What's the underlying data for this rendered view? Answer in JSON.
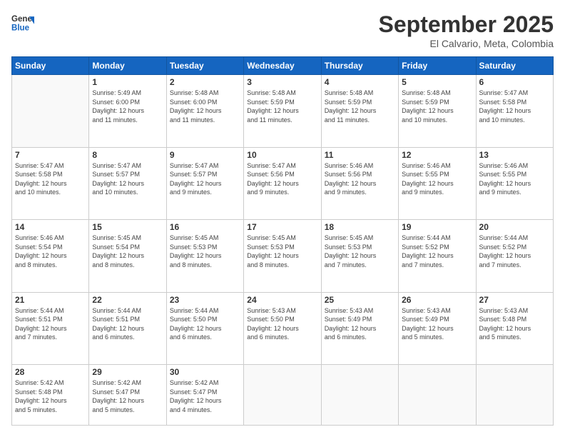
{
  "logo": {
    "line1": "General",
    "line2": "Blue"
  },
  "title": "September 2025",
  "location": "El Calvario, Meta, Colombia",
  "weekdays": [
    "Sunday",
    "Monday",
    "Tuesday",
    "Wednesday",
    "Thursday",
    "Friday",
    "Saturday"
  ],
  "weeks": [
    [
      {
        "day": "",
        "info": ""
      },
      {
        "day": "1",
        "info": "Sunrise: 5:49 AM\nSunset: 6:00 PM\nDaylight: 12 hours\nand 11 minutes."
      },
      {
        "day": "2",
        "info": "Sunrise: 5:48 AM\nSunset: 6:00 PM\nDaylight: 12 hours\nand 11 minutes."
      },
      {
        "day": "3",
        "info": "Sunrise: 5:48 AM\nSunset: 5:59 PM\nDaylight: 12 hours\nand 11 minutes."
      },
      {
        "day": "4",
        "info": "Sunrise: 5:48 AM\nSunset: 5:59 PM\nDaylight: 12 hours\nand 11 minutes."
      },
      {
        "day": "5",
        "info": "Sunrise: 5:48 AM\nSunset: 5:59 PM\nDaylight: 12 hours\nand 10 minutes."
      },
      {
        "day": "6",
        "info": "Sunrise: 5:47 AM\nSunset: 5:58 PM\nDaylight: 12 hours\nand 10 minutes."
      }
    ],
    [
      {
        "day": "7",
        "info": "Sunrise: 5:47 AM\nSunset: 5:58 PM\nDaylight: 12 hours\nand 10 minutes."
      },
      {
        "day": "8",
        "info": "Sunrise: 5:47 AM\nSunset: 5:57 PM\nDaylight: 12 hours\nand 10 minutes."
      },
      {
        "day": "9",
        "info": "Sunrise: 5:47 AM\nSunset: 5:57 PM\nDaylight: 12 hours\nand 9 minutes."
      },
      {
        "day": "10",
        "info": "Sunrise: 5:47 AM\nSunset: 5:56 PM\nDaylight: 12 hours\nand 9 minutes."
      },
      {
        "day": "11",
        "info": "Sunrise: 5:46 AM\nSunset: 5:56 PM\nDaylight: 12 hours\nand 9 minutes."
      },
      {
        "day": "12",
        "info": "Sunrise: 5:46 AM\nSunset: 5:55 PM\nDaylight: 12 hours\nand 9 minutes."
      },
      {
        "day": "13",
        "info": "Sunrise: 5:46 AM\nSunset: 5:55 PM\nDaylight: 12 hours\nand 9 minutes."
      }
    ],
    [
      {
        "day": "14",
        "info": "Sunrise: 5:46 AM\nSunset: 5:54 PM\nDaylight: 12 hours\nand 8 minutes."
      },
      {
        "day": "15",
        "info": "Sunrise: 5:45 AM\nSunset: 5:54 PM\nDaylight: 12 hours\nand 8 minutes."
      },
      {
        "day": "16",
        "info": "Sunrise: 5:45 AM\nSunset: 5:53 PM\nDaylight: 12 hours\nand 8 minutes."
      },
      {
        "day": "17",
        "info": "Sunrise: 5:45 AM\nSunset: 5:53 PM\nDaylight: 12 hours\nand 8 minutes."
      },
      {
        "day": "18",
        "info": "Sunrise: 5:45 AM\nSunset: 5:53 PM\nDaylight: 12 hours\nand 7 minutes."
      },
      {
        "day": "19",
        "info": "Sunrise: 5:44 AM\nSunset: 5:52 PM\nDaylight: 12 hours\nand 7 minutes."
      },
      {
        "day": "20",
        "info": "Sunrise: 5:44 AM\nSunset: 5:52 PM\nDaylight: 12 hours\nand 7 minutes."
      }
    ],
    [
      {
        "day": "21",
        "info": "Sunrise: 5:44 AM\nSunset: 5:51 PM\nDaylight: 12 hours\nand 7 minutes."
      },
      {
        "day": "22",
        "info": "Sunrise: 5:44 AM\nSunset: 5:51 PM\nDaylight: 12 hours\nand 6 minutes."
      },
      {
        "day": "23",
        "info": "Sunrise: 5:44 AM\nSunset: 5:50 PM\nDaylight: 12 hours\nand 6 minutes."
      },
      {
        "day": "24",
        "info": "Sunrise: 5:43 AM\nSunset: 5:50 PM\nDaylight: 12 hours\nand 6 minutes."
      },
      {
        "day": "25",
        "info": "Sunrise: 5:43 AM\nSunset: 5:49 PM\nDaylight: 12 hours\nand 6 minutes."
      },
      {
        "day": "26",
        "info": "Sunrise: 5:43 AM\nSunset: 5:49 PM\nDaylight: 12 hours\nand 5 minutes."
      },
      {
        "day": "27",
        "info": "Sunrise: 5:43 AM\nSunset: 5:48 PM\nDaylight: 12 hours\nand 5 minutes."
      }
    ],
    [
      {
        "day": "28",
        "info": "Sunrise: 5:42 AM\nSunset: 5:48 PM\nDaylight: 12 hours\nand 5 minutes."
      },
      {
        "day": "29",
        "info": "Sunrise: 5:42 AM\nSunset: 5:47 PM\nDaylight: 12 hours\nand 5 minutes."
      },
      {
        "day": "30",
        "info": "Sunrise: 5:42 AM\nSunset: 5:47 PM\nDaylight: 12 hours\nand 4 minutes."
      },
      {
        "day": "",
        "info": ""
      },
      {
        "day": "",
        "info": ""
      },
      {
        "day": "",
        "info": ""
      },
      {
        "day": "",
        "info": ""
      }
    ]
  ]
}
